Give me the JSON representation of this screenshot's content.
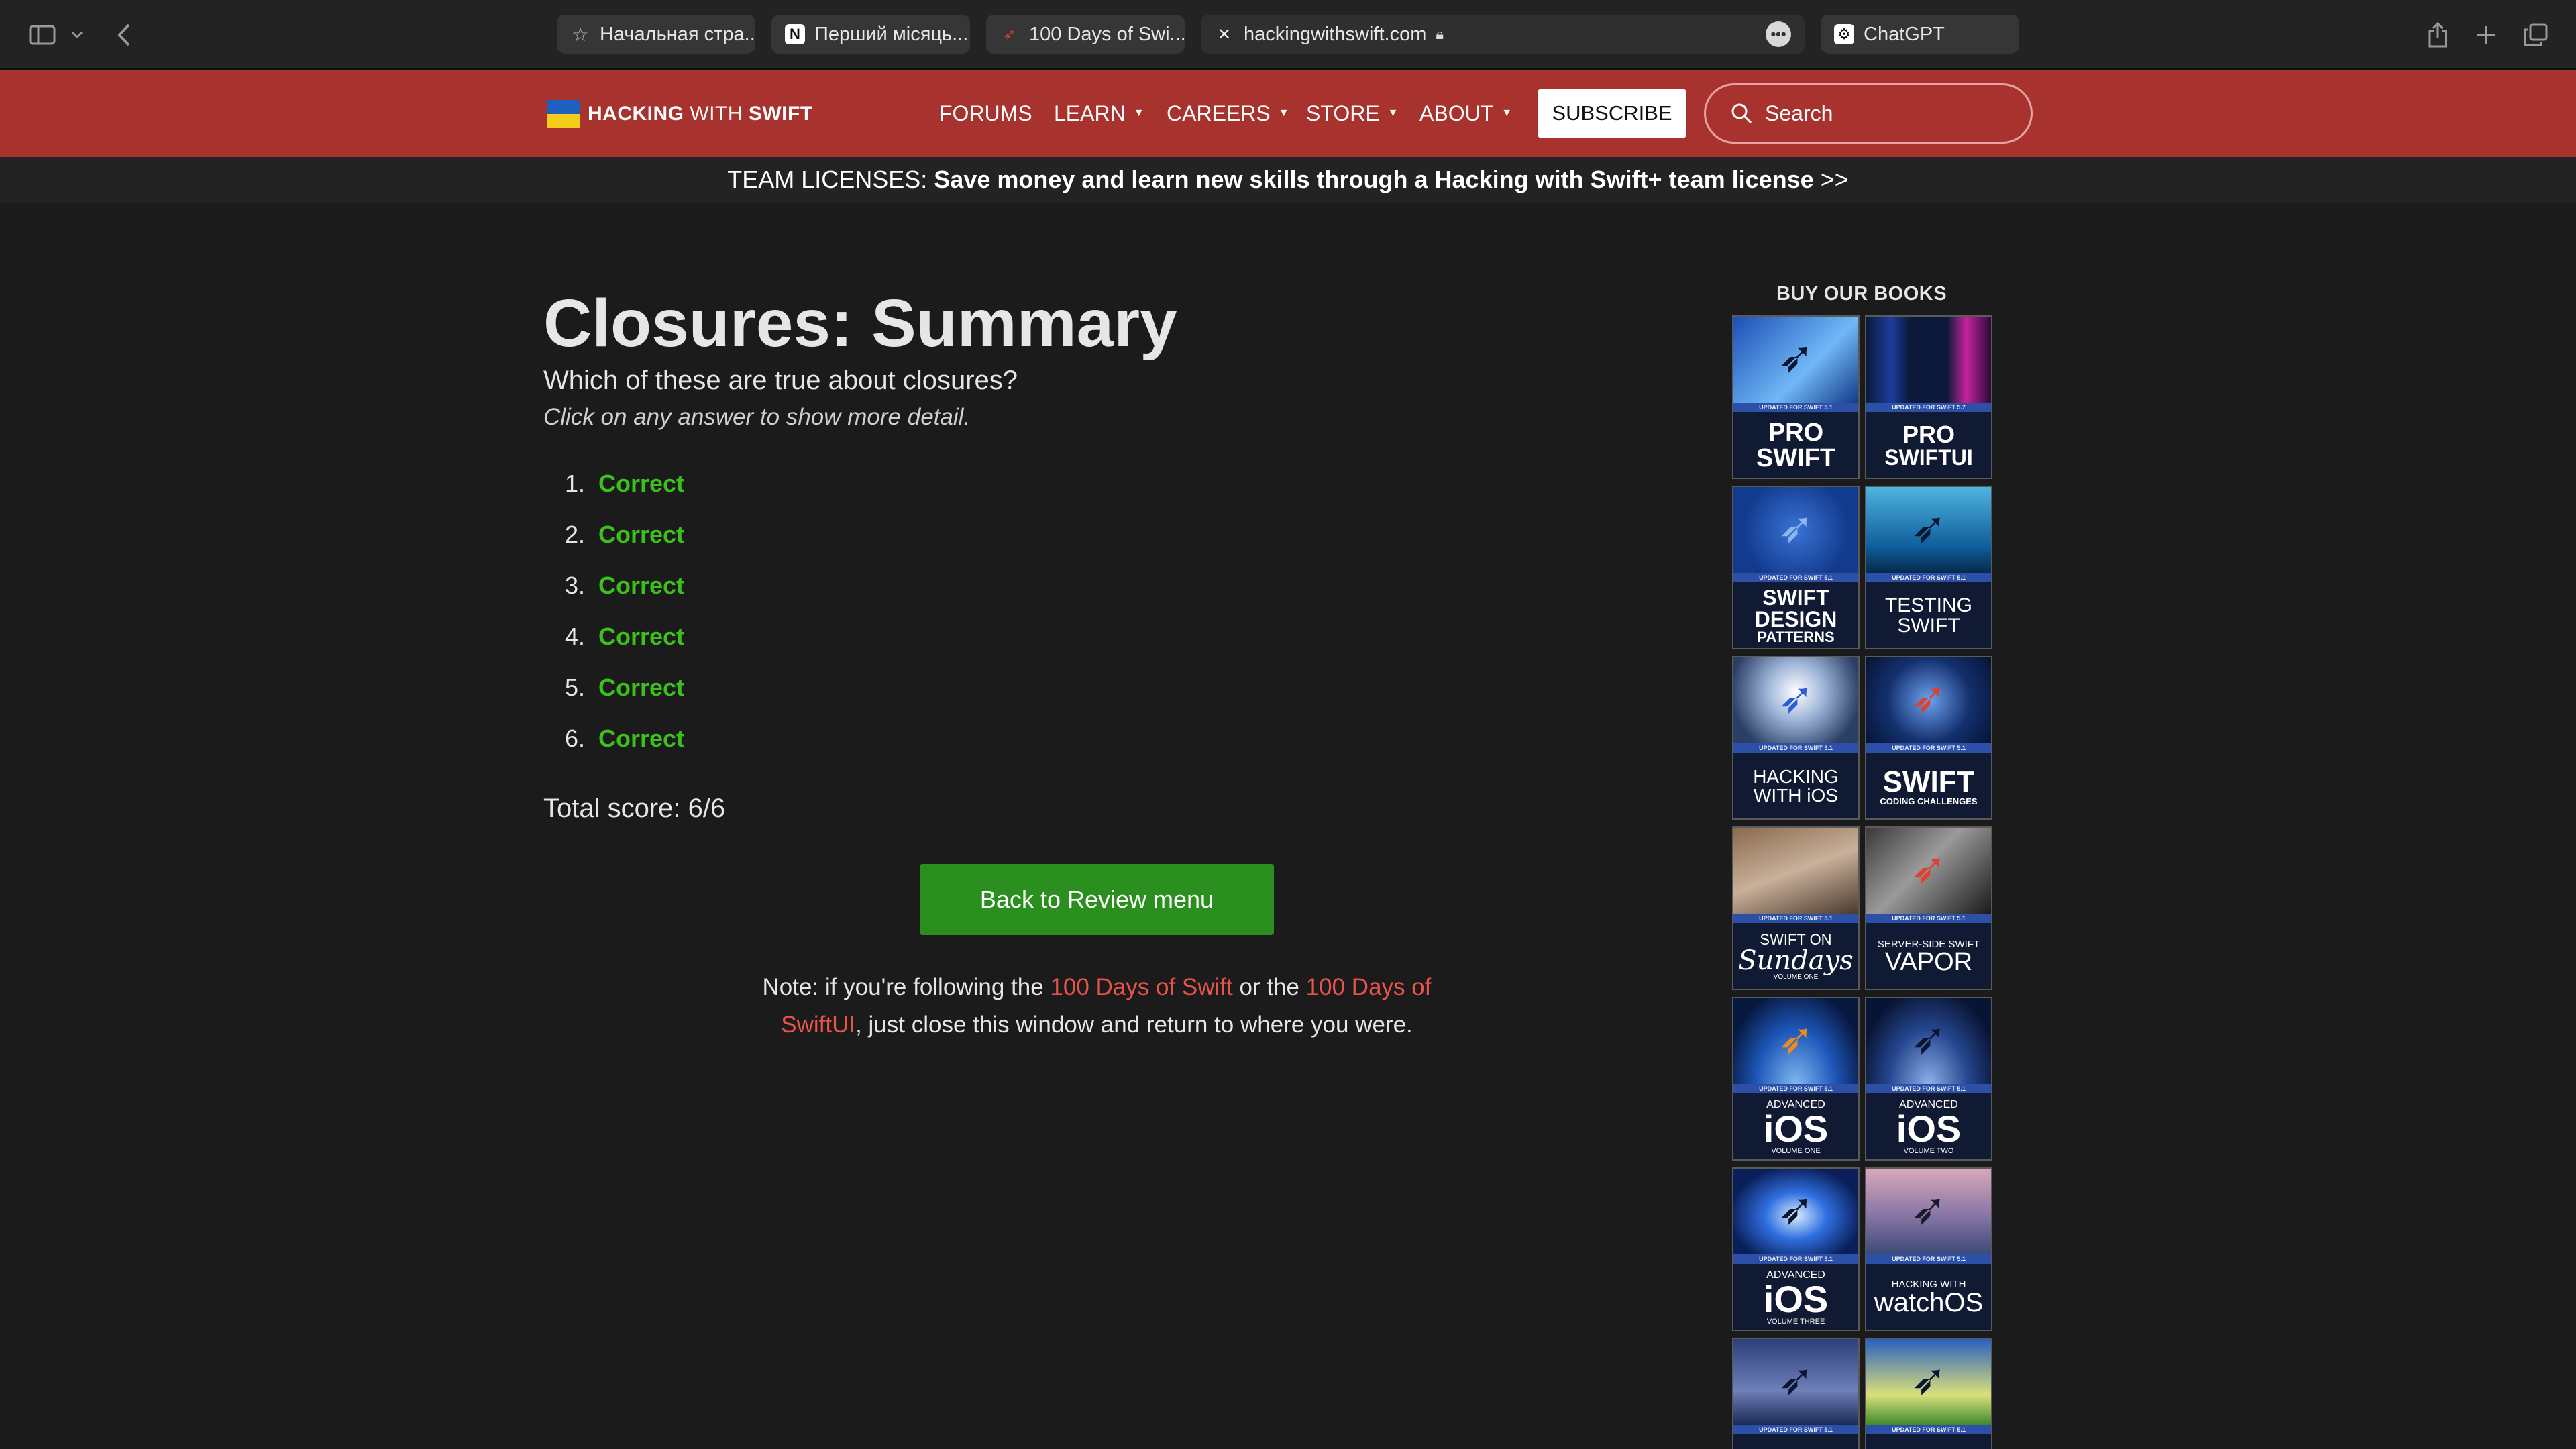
{
  "browser": {
    "tabs": [
      {
        "label": "Начальная стра...",
        "icon": "star-icon"
      },
      {
        "label": "Перший місяць...",
        "icon": "notion-icon"
      },
      {
        "label": "100 Days of Swi...",
        "icon": "swift-icon"
      },
      {
        "label": "hackingwithswift.com",
        "icon": "close-icon"
      },
      {
        "label": "ChatGPT",
        "icon": "chatgpt-icon"
      }
    ]
  },
  "site": {
    "logo_part1": "HACKING",
    "logo_part2": "WITH",
    "logo_part3": "SWIFT",
    "nav": [
      {
        "label": "FORUMS"
      },
      {
        "label": "LEARN"
      },
      {
        "label": "CAREERS"
      },
      {
        "label": "STORE"
      },
      {
        "label": "ABOUT"
      }
    ],
    "subscribe": "SUBSCRIBE",
    "search_placeholder": "Search"
  },
  "banner": {
    "prefix": "TEAM LICENSES: ",
    "text": "Save money and learn new skills through a Hacking with Swift+ team license",
    "suffix": " >>"
  },
  "main": {
    "title": "Closures: Summary",
    "question": "Which of these are true about closures?",
    "hint": "Click on any answer to show more detail.",
    "answers": [
      {
        "num": "1.",
        "result": "Correct"
      },
      {
        "num": "2.",
        "result": "Correct"
      },
      {
        "num": "3.",
        "result": "Correct"
      },
      {
        "num": "4.",
        "result": "Correct"
      },
      {
        "num": "5.",
        "result": "Correct"
      },
      {
        "num": "6.",
        "result": "Correct"
      }
    ],
    "score": "Total score: 6/6",
    "back_button": "Back to Review menu",
    "note": {
      "part1": "Note: if you're following the ",
      "link1": "100 Days of Swift",
      "part2": " or the ",
      "link2": "100 Days of SwiftUI",
      "part3": ", just close this window and return to where you were."
    }
  },
  "sidebar": {
    "title": "BUY OUR BOOKS",
    "books": [
      {
        "line1": "PRO",
        "line2": "SWIFT",
        "line3": "",
        "updated": "UPDATED FOR SWIFT 5.1"
      },
      {
        "line1": "PRO",
        "line2": "SWIFTUI",
        "line3": "",
        "updated": "UPDATED FOR SWIFT 5.7"
      },
      {
        "line1": "SWIFT",
        "line2": "DESIGN",
        "line3": "PATTERNS",
        "updated": "UPDATED FOR SWIFT 5.1"
      },
      {
        "line1": "TESTING",
        "line2": "SWIFT",
        "line3": "",
        "updated": "UPDATED FOR SWIFT 5.1"
      },
      {
        "line1": "HACKING",
        "line2": "WITH iOS",
        "line3": "",
        "updated": "UPDATED FOR SWIFT 5.1"
      },
      {
        "line1": "SWIFT",
        "line2": "CODING CHALLENGES",
        "line3": "",
        "updated": "UPDATED FOR SWIFT 5.1"
      },
      {
        "line1": "SWIFT ON",
        "line2": "Sundays",
        "line3": "VOLUME ONE",
        "updated": "UPDATED FOR SWIFT 5.1"
      },
      {
        "line1": "SERVER-SIDE SWIFT",
        "line2": "VAPOR",
        "line3": "",
        "updated": "UPDATED FOR SWIFT 5.1"
      },
      {
        "line1": "ADVANCED",
        "line2": "iOS",
        "line3": "VOLUME ONE",
        "updated": "UPDATED FOR SWIFT 5.1"
      },
      {
        "line1": "ADVANCED",
        "line2": "iOS",
        "line3": "VOLUME TWO",
        "updated": "UPDATED FOR SWIFT 5.1"
      },
      {
        "line1": "ADVANCED",
        "line2": "iOS",
        "line3": "VOLUME THREE",
        "updated": "UPDATED FOR SWIFT 5.1"
      },
      {
        "line1": "HACKING WITH",
        "line2": "watchOS",
        "line3": "",
        "updated": "UPDATED FOR SWIFT 5.1"
      },
      {
        "line1": "",
        "line2": "",
        "line3": "",
        "updated": "UPDATED FOR SWIFT 5.1"
      },
      {
        "line1": "",
        "line2": "",
        "line3": "",
        "updated": "UPDATED FOR SWIFT 5.1"
      }
    ]
  }
}
